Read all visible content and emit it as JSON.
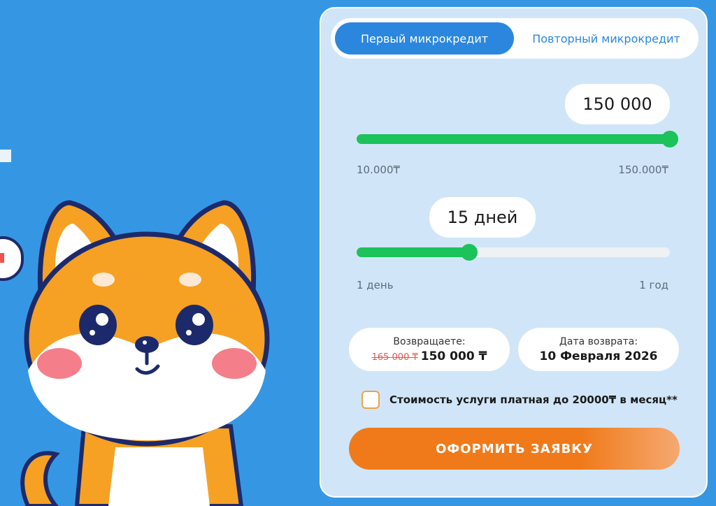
{
  "tabs": {
    "first": "Первый микрокредит",
    "repeat": "Повторный микрокредит"
  },
  "amount": {
    "value": "150 000",
    "min_label": "10.000₸",
    "max_label": "150.000₸",
    "slider_fraction": 1.0
  },
  "term": {
    "value": "15 дней",
    "min_label": "1 день",
    "max_label": "1 год",
    "slider_fraction": 0.36
  },
  "summary": {
    "return_label": "Возвращаете:",
    "old_amount": "165 000 ₸",
    "new_amount": "150 000 ₸",
    "date_label": "Дата возврата:",
    "date_value": "10 Февраля 2026"
  },
  "fee": {
    "text": "Стоимость услуги платная до 20000₸ в месяц**",
    "checked": false
  },
  "submit_label": "ОФОРМИТЬ ЗАЯВКУ",
  "colors": {
    "background": "#3597e4",
    "card": "#d0e6f8",
    "accent_blue": "#2b87de",
    "slider_green": "#1cc25a",
    "button_orange": "#f07a1a"
  }
}
